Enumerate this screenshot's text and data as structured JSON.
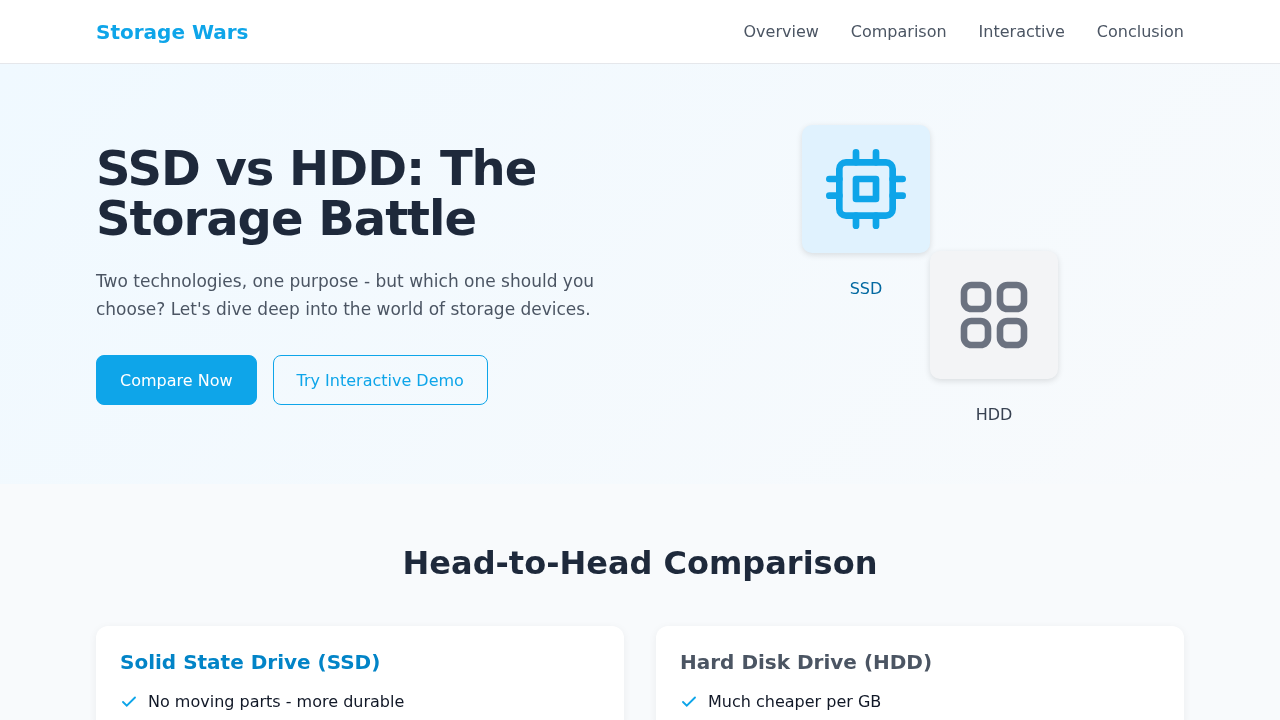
{
  "nav": {
    "brand": "Storage Wars",
    "links": [
      "Overview",
      "Comparison",
      "Interactive",
      "Conclusion"
    ]
  },
  "hero": {
    "title": "SSD vs HDD: The Storage Battle",
    "subtitle": "Two technologies, one purpose - but which one should you choose? Let's dive deep into the world of storage devices.",
    "buttons": [
      {
        "label": "Compare Now",
        "kind": "primary"
      },
      {
        "label": "Try Interactive Demo",
        "kind": "outline"
      }
    ],
    "drives": [
      {
        "label": "SSD",
        "kind": "ssd"
      },
      {
        "label": "HDD",
        "kind": "hdd"
      }
    ]
  },
  "comparison": {
    "heading": "Head-to-Head Comparison",
    "cards": [
      {
        "title": "Solid State Drive (SSD)",
        "kind": "ssd",
        "points": [
          "No moving parts - more durable"
        ]
      },
      {
        "title": "Hard Disk Drive (HDD)",
        "kind": "hdd",
        "points": [
          "Much cheaper per GB"
        ]
      }
    ]
  }
}
